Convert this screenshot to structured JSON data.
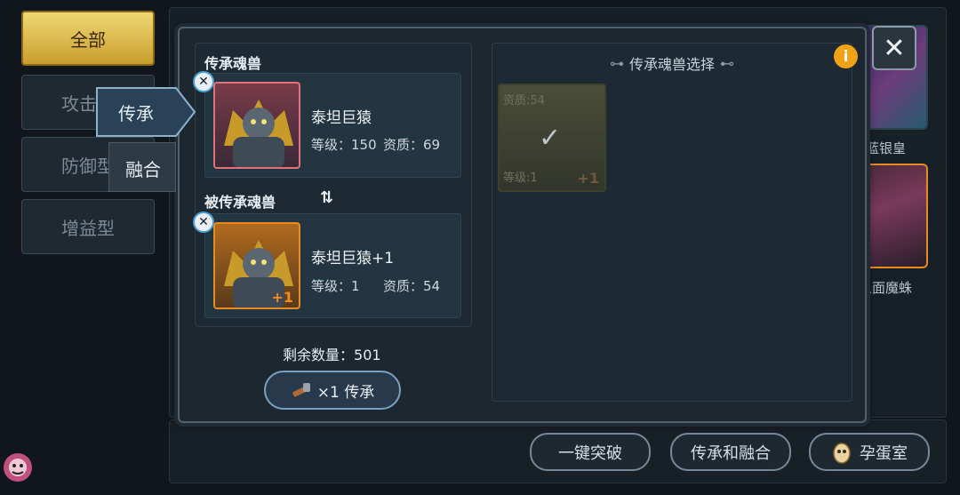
{
  "sidebar": {
    "filters": [
      {
        "label": "全部",
        "active": true
      },
      {
        "label": "攻击型",
        "active": false
      },
      {
        "label": "防御型",
        "active": false
      },
      {
        "label": "增益型",
        "active": false
      }
    ]
  },
  "tabs": {
    "inherit": "传承",
    "fusion": "融合"
  },
  "background_cards": [
    {
      "name": "蓝银皇"
    },
    {
      "name": "人面魔蛛"
    }
  ],
  "modal": {
    "source_section_title": "传承魂兽",
    "target_section_title": "被传承魂兽",
    "swap_icon": "swap-arrows-icon",
    "source": {
      "name": "泰坦巨猿",
      "level_label": "等级：",
      "level": "150",
      "quality_label": "资质：",
      "quality": "69",
      "frame_color": "#e0707a"
    },
    "target": {
      "name": "泰坦巨猿+1",
      "level_label": "等级：",
      "level": "1",
      "quality_label": "资质：",
      "quality": "54",
      "badge": "+1",
      "frame_color": "#e88a22"
    },
    "remaining_label": "剩余数量：",
    "remaining": "501",
    "inherit_button": {
      "cost": "×1 传承"
    },
    "selection_title": "传承魂兽选择",
    "selection_items": [
      {
        "quality_text": "资质:54",
        "level_text": "等级:1",
        "badge": "+1",
        "selected": true
      }
    ]
  },
  "bottom_buttons": {
    "breakthrough": "一键突破",
    "inherit_fuse": "传承和融合",
    "hatchery": "孕蛋室"
  },
  "colors": {
    "accent_gold": "#f0d873",
    "orange_badge": "#e88a22",
    "info": "#f2a216"
  }
}
